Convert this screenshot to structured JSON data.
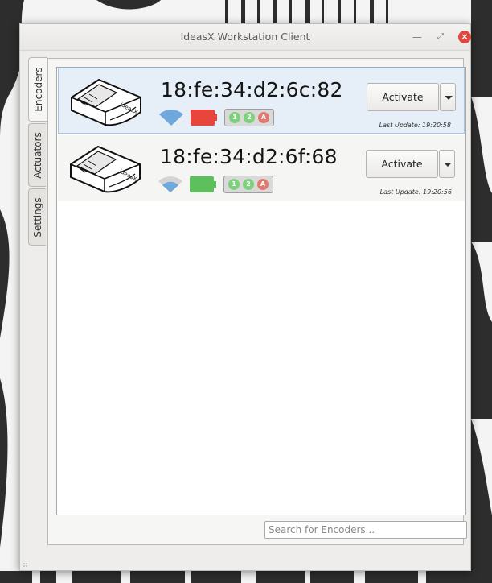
{
  "window": {
    "title": "IdeasX Workstation Client"
  },
  "tabs": [
    "Encoders",
    "Actuators",
    "Settings"
  ],
  "encoders": [
    {
      "mac": "18:fe:34:d2:6c:82",
      "wifi": "strong",
      "battery_color": "#e8463c",
      "buttons": [
        "1",
        "2",
        "A"
      ],
      "button_colors": [
        "#7ed07e",
        "#7ed07e",
        "#e07a70"
      ],
      "action_label": "Activate",
      "last_update": "Last Update: 19:20:58"
    },
    {
      "mac": "18:fe:34:d2:6f:68",
      "wifi": "medium",
      "battery_color": "#5cc05c",
      "buttons": [
        "1",
        "2",
        "A"
      ],
      "button_colors": [
        "#7ed07e",
        "#7ed07e",
        "#e07a70"
      ],
      "action_label": "Activate",
      "last_update": "Last Update: 19:20:56"
    }
  ],
  "search": {
    "placeholder": "Search for Encoders..."
  },
  "colors": {
    "wifi_blue": "#6fa8dc",
    "wifi_faded": "#d4d4d4",
    "window_close": "#e0483e"
  }
}
